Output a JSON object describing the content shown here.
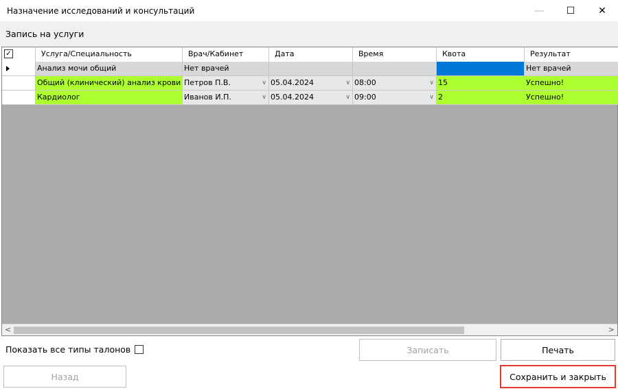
{
  "window": {
    "title": "Назначение исследований и консультаций",
    "minimize": "—",
    "maximize": "☐",
    "close": "✕"
  },
  "section_title": "Запись на услуги",
  "grid": {
    "header_check": "✓",
    "columns": [
      "Услуга/Специальность",
      "Врач/Кабинет",
      "Дата",
      "Время",
      "Квота",
      "Результат"
    ],
    "rows": [
      {
        "service": "Анализ мочи общий",
        "doctor": "Нет врачей",
        "date": "",
        "time": "",
        "quota": "",
        "result": "Нет врачей",
        "current": true
      },
      {
        "service": "Общий (клинический) анализ крови",
        "doctor": "Петров П.В.",
        "date": "05.04.2024",
        "time": "08:00",
        "quota": "15",
        "result": "Успешно!"
      },
      {
        "service": "Кардиолог",
        "doctor": "Иванов И.П.",
        "date": "05.04.2024",
        "time": "09:00",
        "quota": "2",
        "result": "Успешно!"
      }
    ],
    "dropdown_glyph": "∨",
    "scroll_left": "<",
    "scroll_right": ">"
  },
  "show_all_label": "Показать все типы талонов",
  "buttons": {
    "register": "Записать",
    "print": "Печать",
    "back": "Назад",
    "save_close": "Сохранить и закрыть"
  },
  "colors": {
    "success": "#adff2f",
    "no_doctors": "#d8d8d8",
    "selected": "#0078d7",
    "grid_background": "#ababab",
    "highlight_border": "#e03a2e"
  }
}
